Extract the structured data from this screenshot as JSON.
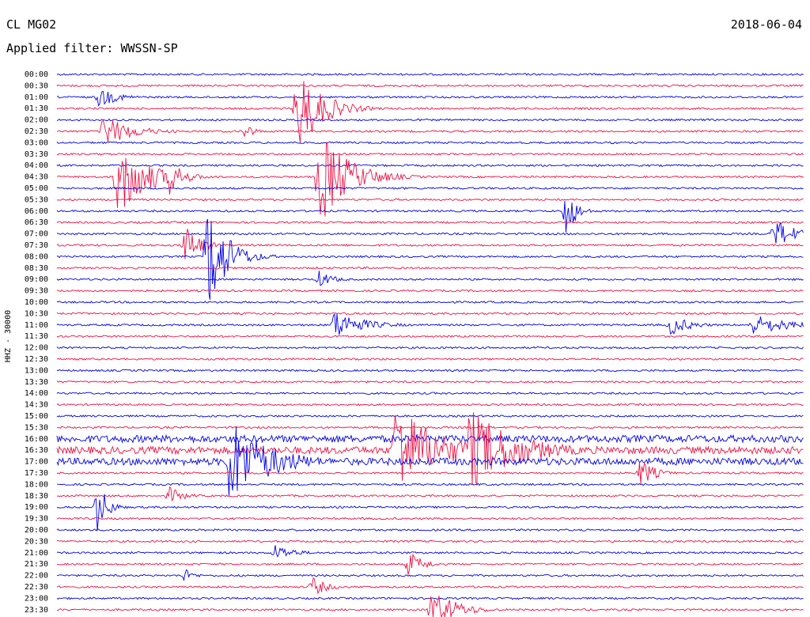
{
  "header": {
    "station": "CL MG02",
    "filter": "Applied filter: WWSSN-SP",
    "date": "2018-06-04"
  },
  "chart_data": {
    "type": "line",
    "title": "CL MG02",
    "subtitle": "Applied filter: WWSSN-SP",
    "ylabel": "HHZ - 30000",
    "xlabel": "",
    "colors": [
      "#0000e6",
      "#ee1144"
    ],
    "categories": [
      "00:00",
      "00:30",
      "01:00",
      "01:30",
      "02:00",
      "02:30",
      "03:00",
      "03:30",
      "04:00",
      "04:30",
      "05:00",
      "05:30",
      "06:00",
      "06:30",
      "07:00",
      "07:30",
      "08:00",
      "08:30",
      "09:00",
      "09:30",
      "10:00",
      "10:30",
      "11:00",
      "11:30",
      "12:00",
      "12:30",
      "13:00",
      "13:30",
      "14:00",
      "14:30",
      "15:00",
      "15:30",
      "16:00",
      "16:30",
      "17:00",
      "17:30",
      "18:00",
      "18:30",
      "19:00",
      "19:30",
      "20:00",
      "20:30",
      "21:00",
      "21:30",
      "22:00",
      "22:30",
      "23:00",
      "23:30"
    ],
    "events": [
      {
        "row": 2,
        "x": 0.055,
        "amp": 14,
        "dur": 0.04
      },
      {
        "row": 3,
        "x": 0.32,
        "amp": 60,
        "dur": 0.05
      },
      {
        "row": 5,
        "x": 0.06,
        "amp": 22,
        "dur": 0.06
      },
      {
        "row": 5,
        "x": 0.25,
        "amp": 12,
        "dur": 0.02
      },
      {
        "row": 9,
        "x": 0.08,
        "amp": 55,
        "dur": 0.06
      },
      {
        "row": 9,
        "x": 0.15,
        "amp": 25,
        "dur": 0.03
      },
      {
        "row": 9,
        "x": 0.35,
        "amp": 65,
        "dur": 0.06
      },
      {
        "row": 12,
        "x": 0.68,
        "amp": 40,
        "dur": 0.02
      },
      {
        "row": 14,
        "x": 0.96,
        "amp": 22,
        "dur": 0.04
      },
      {
        "row": 15,
        "x": 0.17,
        "amp": 30,
        "dur": 0.03
      },
      {
        "row": 16,
        "x": 0.2,
        "amp": 80,
        "dur": 0.04
      },
      {
        "row": 18,
        "x": 0.35,
        "amp": 12,
        "dur": 0.03
      },
      {
        "row": 22,
        "x": 0.37,
        "amp": 20,
        "dur": 0.06
      },
      {
        "row": 22,
        "x": 0.82,
        "amp": 15,
        "dur": 0.04
      },
      {
        "row": 22,
        "x": 0.93,
        "amp": 14,
        "dur": 0.08
      },
      {
        "row": 33,
        "x": 0.45,
        "amp": 65,
        "dur": 0.09
      },
      {
        "row": 33,
        "x": 0.55,
        "amp": 55,
        "dur": 0.1
      },
      {
        "row": 34,
        "x": 0.23,
        "amp": 60,
        "dur": 0.08
      },
      {
        "row": 35,
        "x": 0.78,
        "amp": 20,
        "dur": 0.03
      },
      {
        "row": 37,
        "x": 0.15,
        "amp": 12,
        "dur": 0.03
      },
      {
        "row": 38,
        "x": 0.053,
        "amp": 40,
        "dur": 0.02
      },
      {
        "row": 42,
        "x": 0.29,
        "amp": 12,
        "dur": 0.04
      },
      {
        "row": 43,
        "x": 0.47,
        "amp": 18,
        "dur": 0.03
      },
      {
        "row": 44,
        "x": 0.17,
        "amp": 10,
        "dur": 0.02
      },
      {
        "row": 45,
        "x": 0.34,
        "amp": 15,
        "dur": 0.03
      },
      {
        "row": 47,
        "x": 0.5,
        "amp": 30,
        "dur": 0.05
      }
    ]
  }
}
